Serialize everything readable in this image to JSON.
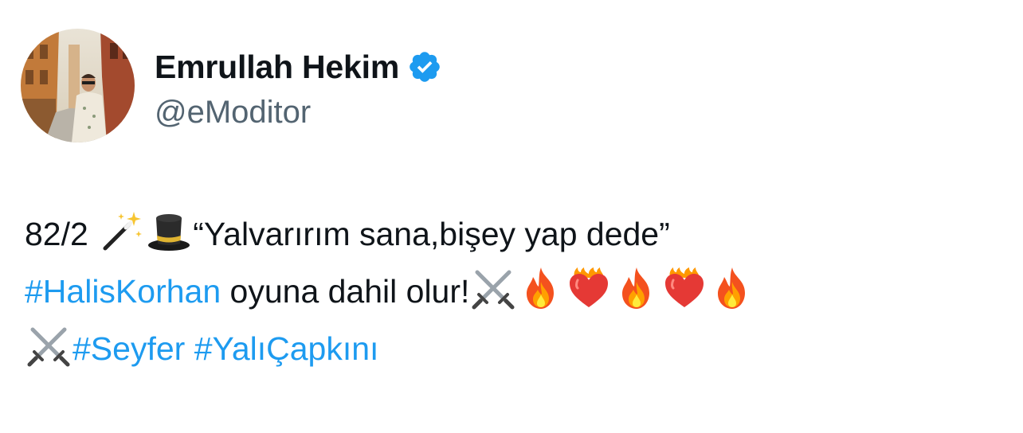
{
  "author": {
    "display_name": "Emrullah Hekim",
    "handle": "@eModitor",
    "verified": true,
    "avatar_icon": "profile-photo",
    "verified_color": "#1d9bf0"
  },
  "tweet": {
    "line1": {
      "prefix": "82/2 ",
      "emoji_1": "magic-wand-icon",
      "emoji_2": "top-hat-icon",
      "quote": "“Yalvarırım sana,bişey yap dede”"
    },
    "line2": {
      "hashtag": "#HalisKorhan",
      "text": " oyuna dahil olur!",
      "emojis": [
        "crossed-swords-icon",
        "fire-icon",
        "heart-on-fire-icon",
        "fire-icon",
        "heart-on-fire-icon",
        "fire-icon"
      ]
    },
    "line3": {
      "emoji": "crossed-swords-icon",
      "hashtag_1": "#Seyfer",
      "hashtag_2": "#YalıÇapkını"
    }
  },
  "colors": {
    "text": "#0f1419",
    "secondary": "#536471",
    "link": "#1d9bf0"
  }
}
